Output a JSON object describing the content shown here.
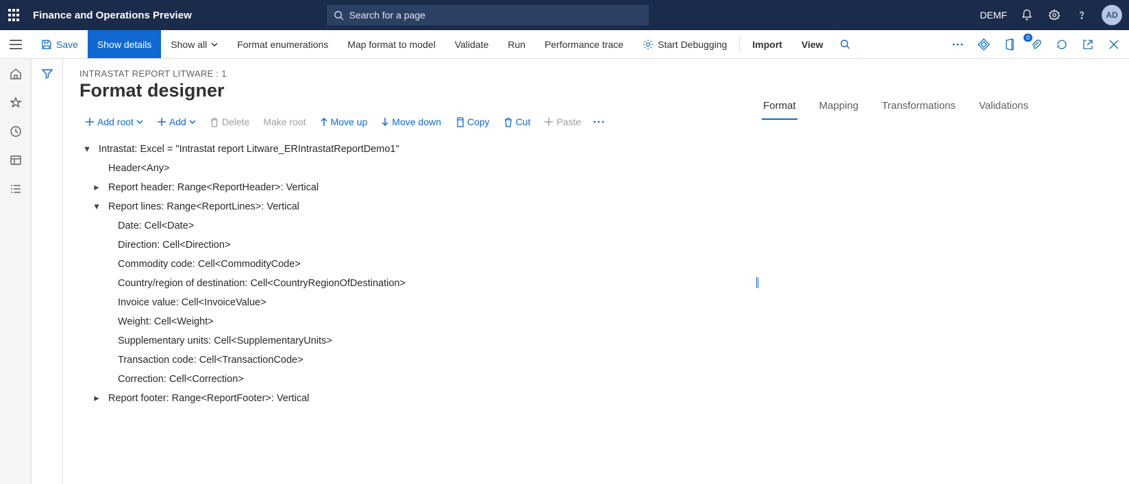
{
  "topbar": {
    "title": "Finance and Operations Preview",
    "search_placeholder": "Search for a page",
    "company": "DEMF",
    "avatar_initials": "AD"
  },
  "cmdbar": {
    "save": "Save",
    "show_details": "Show details",
    "show_all": "Show all",
    "format_enumerations": "Format enumerations",
    "map_format_to_model": "Map format to model",
    "validate": "Validate",
    "run": "Run",
    "performance_trace": "Performance trace",
    "start_debugging": "Start Debugging",
    "import": "Import",
    "view": "View",
    "attachment_count": "0"
  },
  "page": {
    "breadcrumb": "INTRASTAT REPORT LITWARE : 1",
    "title": "Format designer"
  },
  "toolbar": {
    "add_root": "Add root",
    "add": "Add",
    "delete": "Delete",
    "make_root": "Make root",
    "move_up": "Move up",
    "move_down": "Move down",
    "copy": "Copy",
    "cut": "Cut",
    "paste": "Paste"
  },
  "tree": {
    "n0": "Intrastat: Excel = \"Intrastat report Litware_ERIntrastatReportDemo1\"",
    "n1": "Header<Any>",
    "n2": "Report header: Range<ReportHeader>: Vertical",
    "n3": "Report lines: Range<ReportLines>: Vertical",
    "n3_0": "Date: Cell<Date>",
    "n3_1": "Direction: Cell<Direction>",
    "n3_2": "Commodity code: Cell<CommodityCode>",
    "n3_3": "Country/region of destination: Cell<CountryRegionOfDestination>",
    "n3_4": "Invoice value: Cell<InvoiceValue>",
    "n3_5": "Weight: Cell<Weight>",
    "n3_6": "Supplementary units: Cell<SupplementaryUnits>",
    "n3_7": "Transaction code: Cell<TransactionCode>",
    "n3_8": "Correction: Cell<Correction>",
    "n4": "Report footer: Range<ReportFooter>: Vertical"
  },
  "tabs": {
    "format": "Format",
    "mapping": "Mapping",
    "transformations": "Transformations",
    "validations": "Validations"
  }
}
